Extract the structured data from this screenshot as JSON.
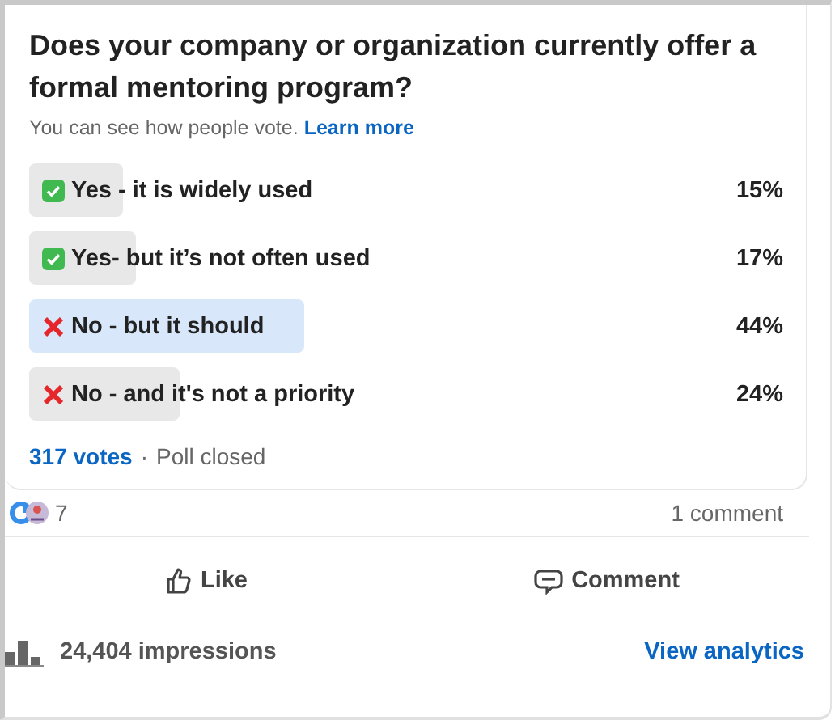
{
  "poll": {
    "question": "Does your company or organization currently offer a formal mentoring program?",
    "note": "You can see how people vote.",
    "note_link": "Learn more",
    "options": [
      {
        "kind": "yes",
        "label": "Yes - it is widely used",
        "percent": "15%",
        "selected": false
      },
      {
        "kind": "yes",
        "label": "Yes- but it’s not often used",
        "percent": "17%",
        "selected": false
      },
      {
        "kind": "no",
        "label": "No - but it should",
        "percent": "44%",
        "selected": true
      },
      {
        "kind": "no",
        "label": "No - and it's not a priority",
        "percent": "24%",
        "selected": false
      }
    ],
    "votes": "317 votes",
    "separator": "·",
    "status": "Poll closed"
  },
  "social": {
    "reaction_count": "7",
    "comments": "1 comment"
  },
  "actions": [
    {
      "kind": "like",
      "label": "Like"
    },
    {
      "kind": "comment",
      "label": "Comment"
    }
  ],
  "footer": {
    "impressions": "24,404 impressions",
    "analytics": "View analytics"
  }
}
